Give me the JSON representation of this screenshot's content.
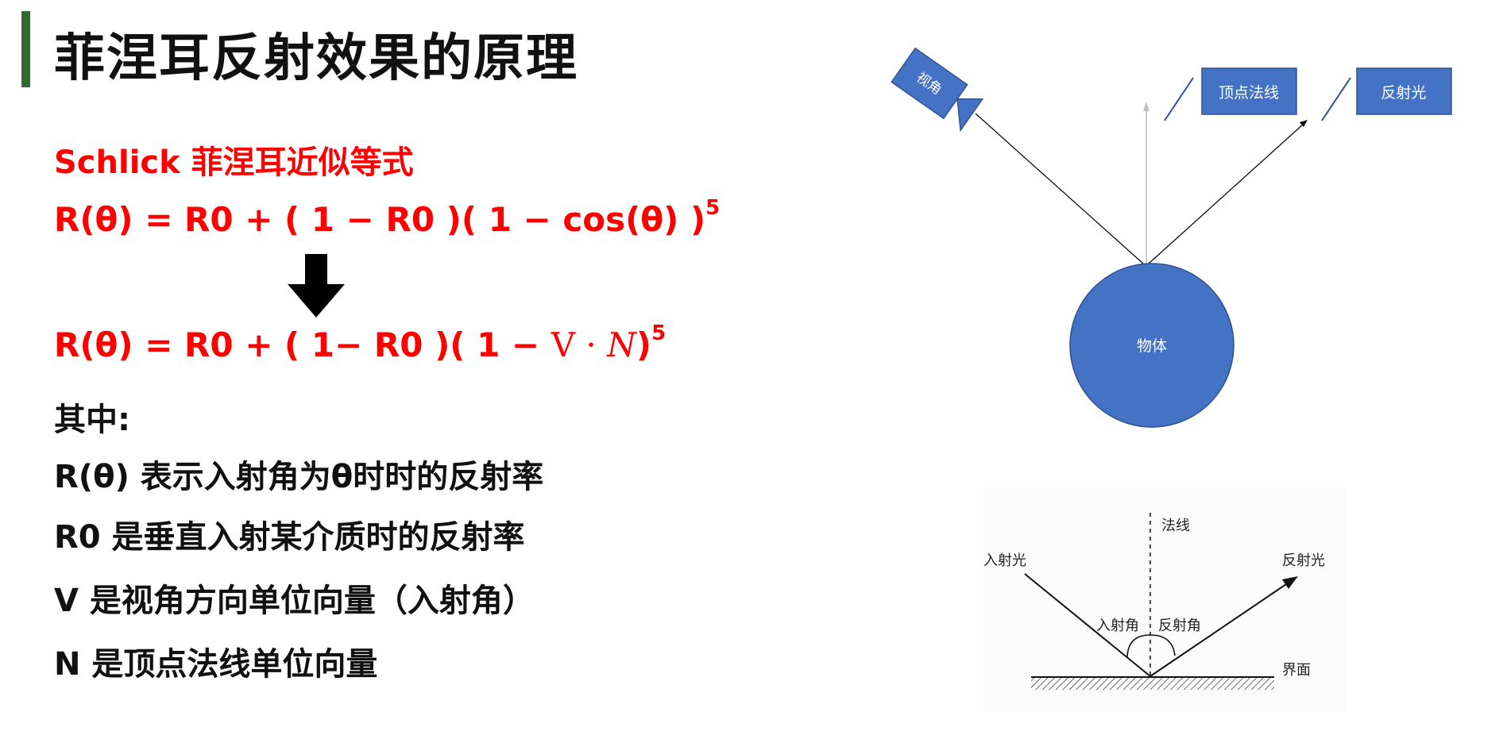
{
  "title": "菲涅耳反射效果的原理",
  "subtitle": "Schlick 菲涅耳近似等式",
  "formula1": {
    "text": "R(θ) = R0 + ( 1 − R0 )( 1 − cos(θ) )",
    "exponent": "5"
  },
  "formula2": {
    "text": "R(θ) = R0 + ( 1− R0 )( 1 − ",
    "v": "V",
    "dot": " · ",
    "n": "N",
    "close": ")",
    "exponent": "5"
  },
  "where_label": "其中:",
  "definitions": [
    "R(θ) 表示入射角为θ时时的反射率",
    "R0 是垂直入射某介质时的反射率",
    "V 是视角方向单位向量（入射角）",
    "N 是顶点法线单位向量"
  ],
  "diagram_top": {
    "camera_label": "视角",
    "normal_label": "顶点法线",
    "reflect_label": "反射光",
    "object_label": "物体",
    "colors": {
      "fill": "#4472c4",
      "stroke": "#2f528f"
    }
  },
  "diagram_bottom": {
    "normal_label": "法线",
    "incident_label": "入射光",
    "reflect_label": "反射光",
    "incident_angle_label": "入射角",
    "reflect_angle_label": "反射角",
    "surface_label": "界面"
  }
}
